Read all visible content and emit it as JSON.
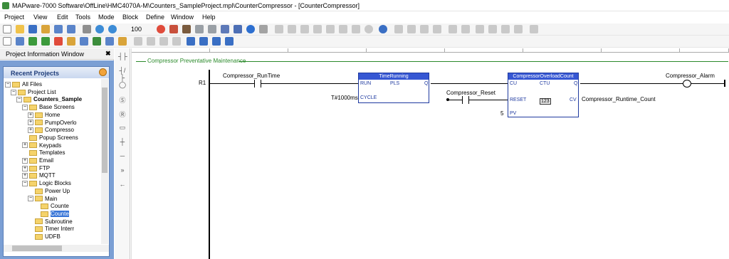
{
  "window": {
    "title": "MAPware-7000 Software\\OffLine\\HMC4070A-M\\Counters_SampleProject.mpl\\CounterCompressor - [CounterCompressor]"
  },
  "menu": [
    "Project",
    "View",
    "Edit",
    "Tools",
    "Mode",
    "Block",
    "Define",
    "Window",
    "Help"
  ],
  "toolbar": {
    "zoom": "100"
  },
  "left_panel": {
    "title": "Project Information Window",
    "close": "✖",
    "recent_title": "Recent Projects",
    "tree": [
      {
        "label": "All Files",
        "toggle": "−"
      },
      {
        "label": "Project List",
        "toggle": "−"
      },
      {
        "label": "Counters_Sample",
        "toggle": "−"
      },
      {
        "label": "Base Screens",
        "toggle": "−"
      },
      {
        "label": "Home",
        "toggle": "+"
      },
      {
        "label": "PumpOverlo",
        "toggle": "+"
      },
      {
        "label": "Compresso",
        "toggle": "+"
      },
      {
        "label": "Popup Screens",
        "toggle": ""
      },
      {
        "label": "Keypads",
        "toggle": "+"
      },
      {
        "label": "Templates",
        "toggle": ""
      },
      {
        "label": "Email",
        "toggle": "+"
      },
      {
        "label": "FTP",
        "toggle": "+"
      },
      {
        "label": "MQTT",
        "toggle": "+"
      },
      {
        "label": "Logic Blocks",
        "toggle": "−"
      },
      {
        "label": "Power Up",
        "toggle": ""
      },
      {
        "label": "Main",
        "toggle": "−"
      },
      {
        "label": "Counte",
        "toggle": ""
      },
      {
        "label": "Counte",
        "toggle": ""
      },
      {
        "label": "Subroutine",
        "toggle": ""
      },
      {
        "label": "Timer Interr",
        "toggle": ""
      },
      {
        "label": "UDFB",
        "toggle": ""
      }
    ]
  },
  "ladder": {
    "rung_title": "Compressor Preventative Maintenance",
    "rung_number": "R1",
    "contact1": "Compressor_RunTime",
    "timer": {
      "name": "TimeRunning",
      "in": "RUN",
      "type": "PLS",
      "out": "Q",
      "cycle_pin": "CYCLE",
      "cycle_value": "T#1000ms"
    },
    "counter": {
      "name": "CompressorOverloadCount",
      "cu": "CU",
      "type": "CTU",
      "q": "Q",
      "reset": "RESET",
      "cv": "CV",
      "pv": "PV",
      "pv_value": "5",
      "badge": "123"
    },
    "reset_contact": "Compressor_Reset",
    "cv_out": "Compressor_Runtime_Count",
    "coil": "Compressor_Alarm"
  }
}
